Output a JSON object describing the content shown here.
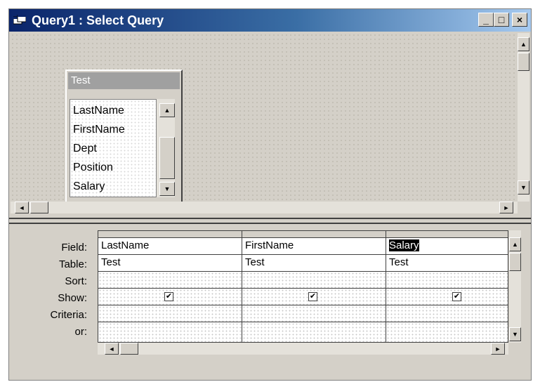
{
  "window": {
    "title": "Query1 : Select Query",
    "minimize": "_",
    "maximize": "□",
    "close": "×"
  },
  "table_box": {
    "title": "Test",
    "fields": [
      "LastName",
      "FirstName",
      "Dept",
      "Position",
      "Salary"
    ]
  },
  "grid": {
    "row_labels": [
      "Field:",
      "Table:",
      "Sort:",
      "Show:",
      "Criteria:",
      "or:"
    ],
    "columns": [
      {
        "field": "LastName",
        "table": "Test",
        "sort": "",
        "show": true,
        "criteria": "",
        "or": ""
      },
      {
        "field": "FirstName",
        "table": "Test",
        "sort": "",
        "show": true,
        "criteria": "",
        "or": ""
      },
      {
        "field": "Salary",
        "table": "Test",
        "sort": "",
        "show": true,
        "criteria": "",
        "or": ""
      }
    ],
    "selected_field": "Salary"
  },
  "scroll": {
    "up": "▲",
    "down": "▼",
    "left": "◄",
    "right": "►"
  }
}
